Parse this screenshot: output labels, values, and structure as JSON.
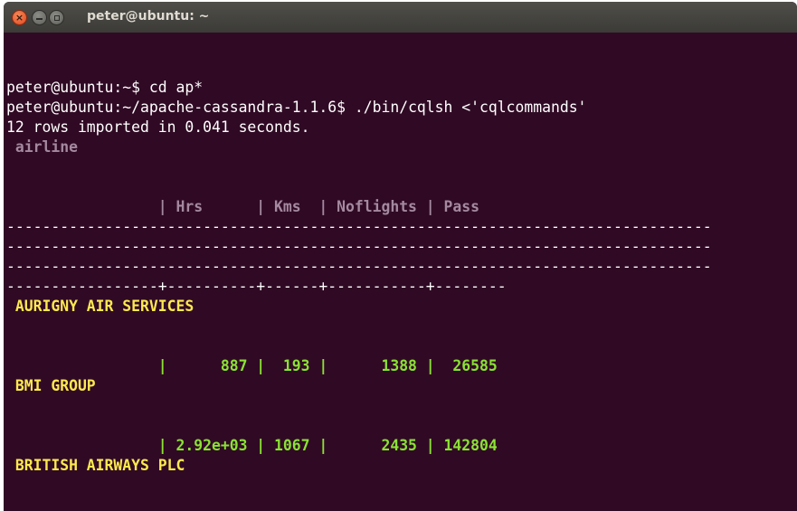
{
  "window": {
    "title": "peter@ubuntu: ~"
  },
  "terminal": {
    "prompt1": "peter@ubuntu:~$ ",
    "cmd1": "cd ap*",
    "prompt2": "peter@ubuntu:~/apache-cassandra-1.1.6$ ",
    "cmd2": "./bin/cqlsh <'cqlcommands'",
    "import_msg": "12 rows imported in 0.041 seconds.",
    "table_name": " airline",
    "header_row": "                 | Hrs      | Kms  | Noflights | Pass",
    "separator_full": "-------------------------------------------------------------------------------",
    "separator_cols": "-----------------+----------+------+-----------+--------",
    "rows": [
      {
        "airline": " AURIGNY AIR SERVICES",
        "values": "                 |      887 |  193 |      1388 |  26585"
      },
      {
        "airline": " BMI GROUP",
        "values": "                 | 2.92e+03 | 1067 |      2435 | 142804"
      },
      {
        "airline": " BRITISH AIRWAYS PLC"
      }
    ]
  },
  "colors": {
    "background": "#300a24",
    "header_text": "#a489a0",
    "airline_name": "#fce94f",
    "numeric_value": "#8ae234"
  }
}
